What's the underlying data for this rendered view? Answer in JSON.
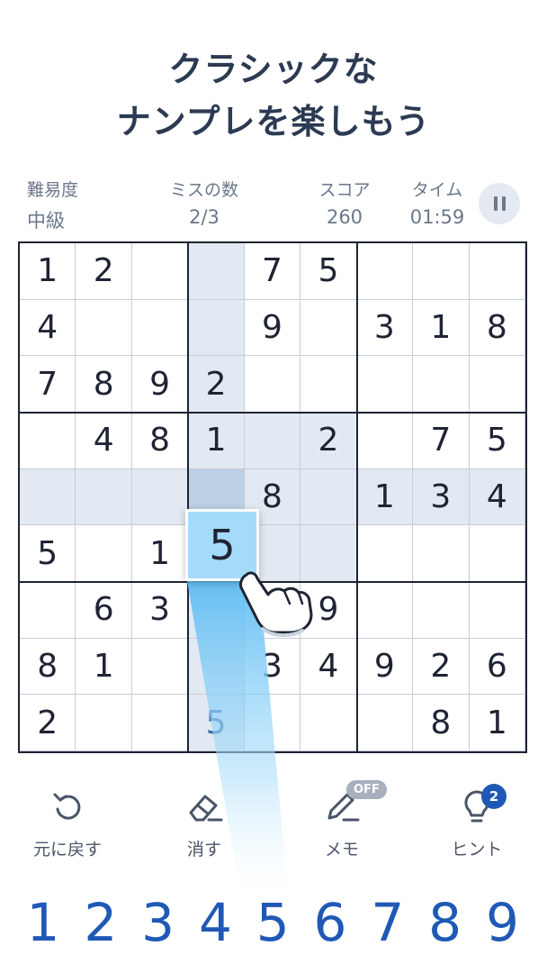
{
  "headline": {
    "line1": "クラシックな",
    "line2": "ナンプレを楽しもう"
  },
  "stats": {
    "difficulty": {
      "label": "難易度",
      "value": "中級"
    },
    "mistakes": {
      "label": "ミスの数",
      "value": "2/3"
    },
    "score": {
      "label": "スコア",
      "value": "260"
    },
    "time": {
      "label": "タイム",
      "value": "01:59"
    }
  },
  "pause_icon": "pause-icon",
  "board": {
    "grid": [
      [
        "1",
        "2",
        "",
        "",
        "7",
        "5",
        "",
        "",
        ""
      ],
      [
        "4",
        "",
        "",
        "",
        "9",
        "",
        "3",
        "1",
        "8"
      ],
      [
        "7",
        "8",
        "9",
        "2",
        "",
        "",
        "",
        "",
        ""
      ],
      [
        "",
        "4",
        "8",
        "1",
        "",
        "2",
        "",
        "7",
        "5"
      ],
      [
        "",
        "",
        "",
        "",
        "8",
        "",
        "1",
        "3",
        "4"
      ],
      [
        "5",
        "",
        "1",
        "",
        "",
        "",
        "",
        "",
        ""
      ],
      [
        "",
        "6",
        "3",
        "",
        "",
        "9",
        "",
        "",
        ""
      ],
      [
        "8",
        "1",
        "",
        "",
        "3",
        "4",
        "9",
        "2",
        "6"
      ],
      [
        "2",
        "",
        "",
        "5",
        "",
        "",
        "",
        "8",
        "1"
      ]
    ],
    "selected_value": "5"
  },
  "toolbar": {
    "undo": "元に戻す",
    "erase": "消す",
    "memo": "メモ",
    "memo_state": "OFF",
    "hint": "ヒント",
    "hint_count": "2"
  },
  "numpad": [
    "1",
    "2",
    "3",
    "4",
    "5",
    "6",
    "7",
    "8",
    "9"
  ],
  "colors": {
    "accent": "#1f59b5",
    "highlight": "#e3e9f2",
    "selected": "#a4dbfb"
  }
}
